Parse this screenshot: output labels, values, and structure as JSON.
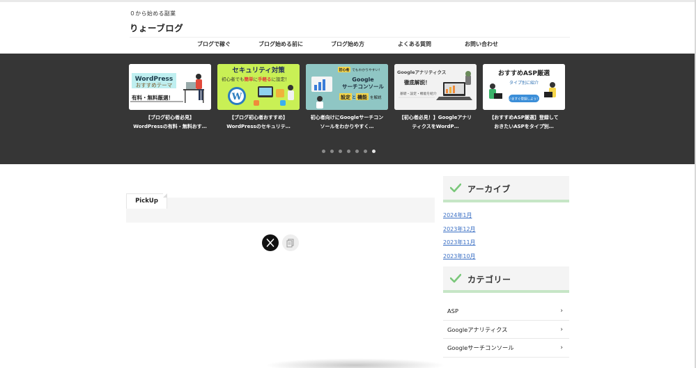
{
  "header": {
    "tagline": "０から始める副業",
    "site_title": "りょーブログ"
  },
  "nav": [
    {
      "label": "ブログで稼ぐ"
    },
    {
      "label": "ブログ始める前に"
    },
    {
      "label": "ブログ始め方"
    },
    {
      "label": "よくある質問"
    },
    {
      "label": "お問い合わせ"
    }
  ],
  "slider": {
    "cards": [
      {
        "caption": "【ブログ初心者必見】\nWordPressの有料・無料おす…",
        "thumb": {
          "line1": "WordPress",
          "line2": "おすすめテーマ",
          "line3": "有料・無料厳選！"
        }
      },
      {
        "caption": "【ブログ初心者おすすめ】\nWordPressのセキュリテ…",
        "thumb": {
          "title": "セキュリティ対策",
          "sub_prefix": "初心者でも",
          "sub_accent": "簡単",
          "sub_mid": "に",
          "sub_accent2": "手軽る",
          "sub_suffix": "に設定！"
        }
      },
      {
        "caption": "初心者向けにGoogleサーチコン\nソールをわかりやすく…",
        "thumb": {
          "badge": "初心者",
          "badge_suffix": "でもわかりやすい！",
          "line1": "Google",
          "line2": "サーチコンソール",
          "accent1": "設定",
          "mid": "と",
          "accent2": "機能",
          "suffix": "を解説"
        }
      },
      {
        "caption": "【初心者必見！】Googleアナリ\nティクスをWordP…",
        "thumb": {
          "line1": "Googleアナリティクス",
          "line2": "徹底解説！",
          "line3": "基礎・設定・機能を紹介"
        }
      },
      {
        "caption": "【おすすめASP厳選】登録して\nおきたいASPをタイプ別…",
        "thumb": {
          "line1": "おすすめASP厳選",
          "line2": "タイプ別に紹介",
          "button": "いますぐ登録しよう！"
        }
      }
    ],
    "dots_count": 7,
    "active_dot": 6
  },
  "pickup": {
    "tab_label": "PickUp"
  },
  "share": {
    "x_icon": "x-logo-icon",
    "copy_icon": "copy-icon"
  },
  "sidebar": {
    "archive": {
      "title": "アーカイブ",
      "links": [
        "2024年1月",
        "2023年12月",
        "2023年11月",
        "2023年10月"
      ]
    },
    "category": {
      "title": "カテゴリー",
      "items": [
        "ASP",
        "Googleアナリティクス",
        "Googleサーチコンソール"
      ]
    }
  },
  "colors": {
    "slider_bg": "#363636",
    "link": "#3a6fc4",
    "accent_green": "#7ac77a",
    "widget_underline": "#c6e6c6"
  }
}
